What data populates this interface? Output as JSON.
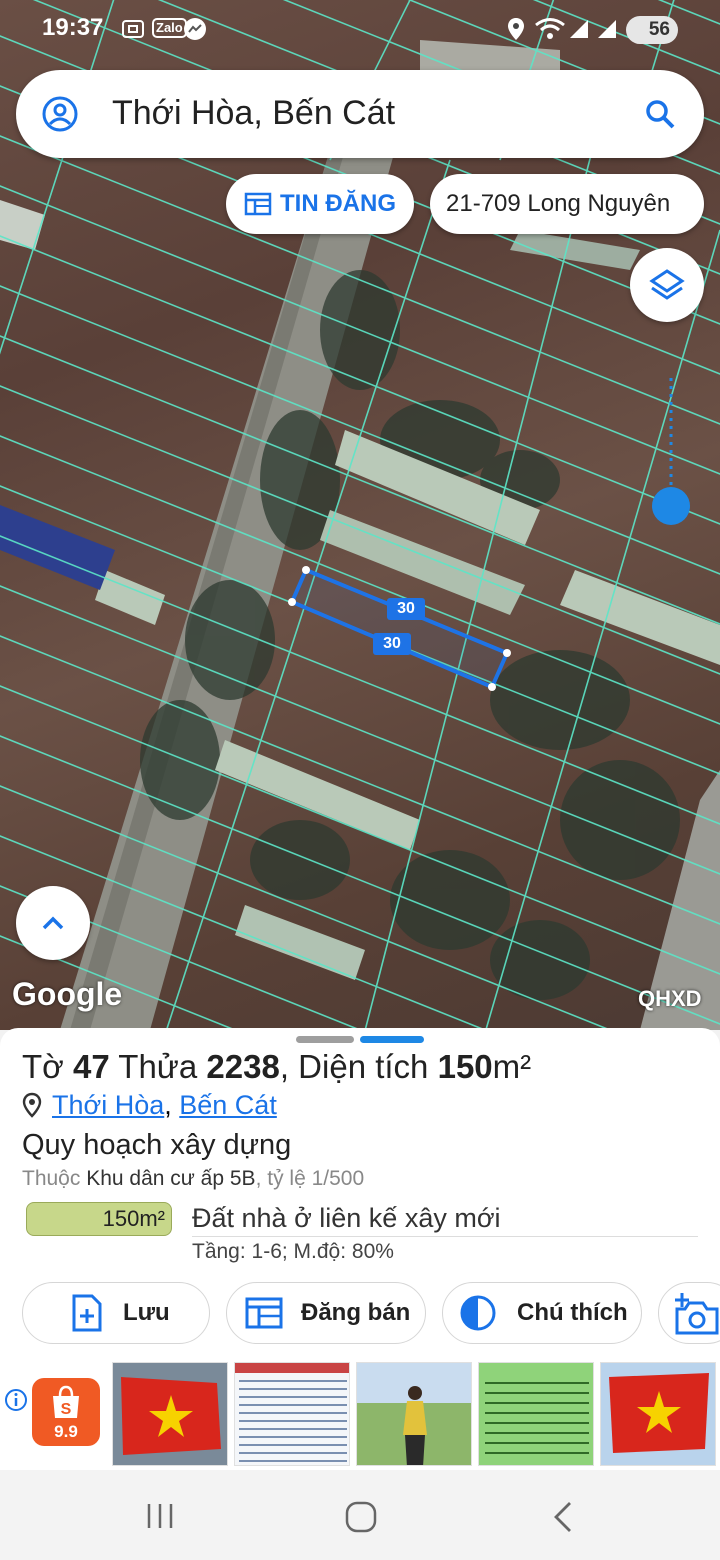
{
  "status_bar": {
    "time": "19:37",
    "zalo_label": "Zalo",
    "battery": "56"
  },
  "search": {
    "query": "Thới Hòa, Bến Cát",
    "icons": {
      "left": "account-circle-icon",
      "right": "search-icon"
    }
  },
  "chips": {
    "tin_dang": "TIN ĐĂNG",
    "address": "21-709 Long Nguyên"
  },
  "map": {
    "measure_labels": [
      "30",
      "30"
    ],
    "google_logo": "Google",
    "layer_label": "QHXD",
    "overlay_color": "#5ce6c8",
    "selection_color": "#1e73e6"
  },
  "parcel": {
    "to_label": "Tờ",
    "to_value": "47",
    "thua_label": "Thửa",
    "thua_value": "2238",
    "area_label": ", Diện tích",
    "area_value": "150",
    "area_unit": "m²",
    "location_ward": "Thới Hòa",
    "location_sep": ", ",
    "location_district": "Bến Cát",
    "plan_heading": "Quy hoạch xây dựng",
    "plan_prefix": "Thuộc",
    "plan_zone": "Khu dân cư ấp 5B",
    "plan_scale": ", tỷ lệ 1/500",
    "badge": "150m²",
    "land_type": "Đất nhà ở liên kế xây mới",
    "floors": "Tầng: 1-6; M.độ: 80%"
  },
  "actions": {
    "save": "Lưu",
    "sell": "Đăng bán",
    "legend": "Chú thích"
  },
  "ads": {
    "shopee_label": "9.9",
    "info_icon": "info-icon"
  },
  "colors": {
    "accent": "#1a73e8",
    "badge_green": "#c7d78a"
  }
}
